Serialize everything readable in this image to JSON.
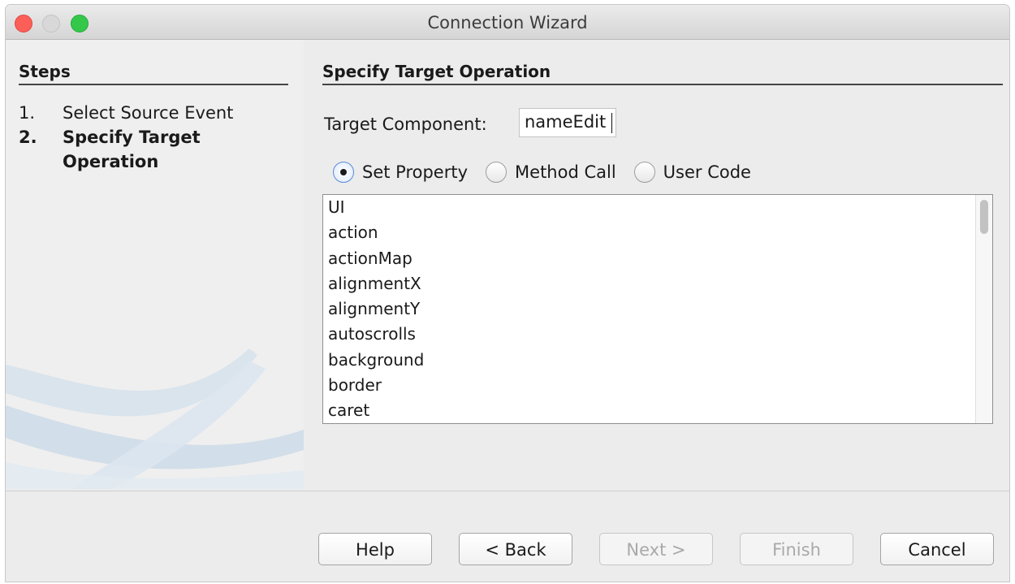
{
  "window": {
    "title": "Connection Wizard"
  },
  "steps": {
    "header": "Steps",
    "items": [
      {
        "num": "1.",
        "label": "Select Source Event",
        "current": false
      },
      {
        "num": "2.",
        "label": "Specify Target Operation",
        "current": true
      }
    ]
  },
  "main": {
    "header": "Specify Target Operation",
    "target_label": "Target Component:",
    "target_value": "nameEdit",
    "radios": [
      {
        "label": "Set Property",
        "selected": true
      },
      {
        "label": "Method Call",
        "selected": false
      },
      {
        "label": "User Code",
        "selected": false
      }
    ],
    "properties": [
      "UI",
      "action",
      "actionMap",
      "alignmentX",
      "alignmentY",
      "autoscrolls",
      "background",
      "border",
      "caret"
    ]
  },
  "buttons": {
    "help": "Help",
    "back": "< Back",
    "next": "Next >",
    "finish": "Finish",
    "cancel": "Cancel"
  }
}
